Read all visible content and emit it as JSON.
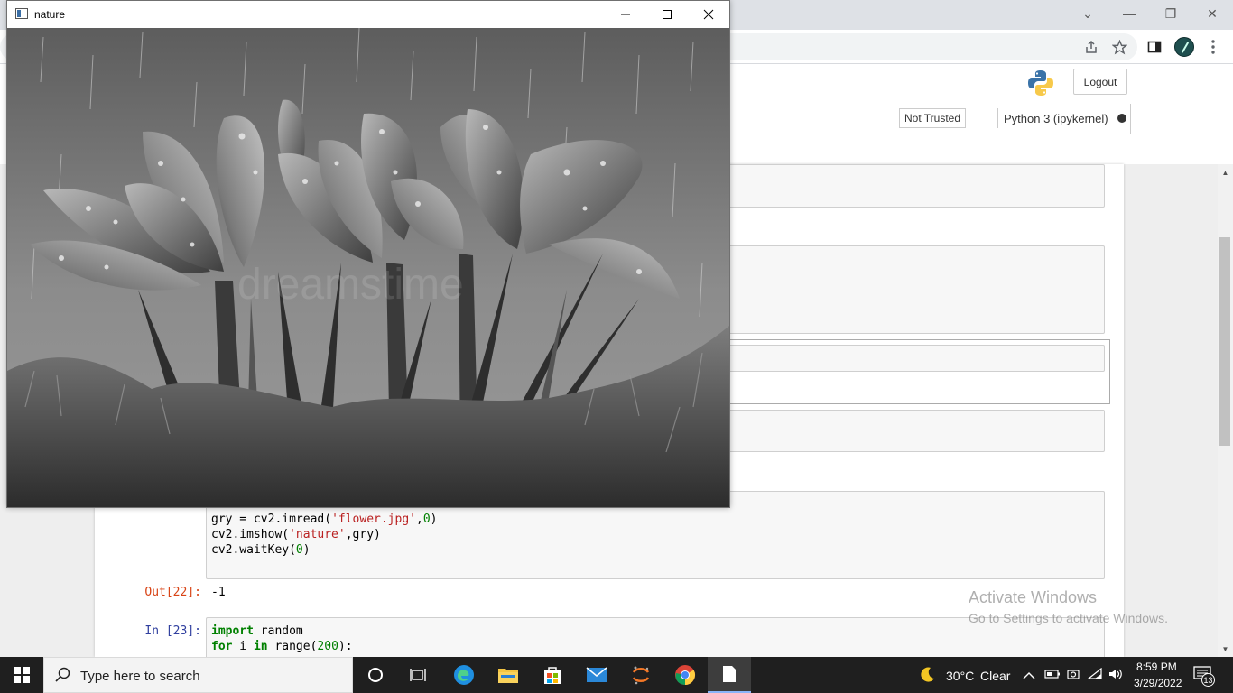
{
  "cv_window": {
    "title": "nature",
    "watermark_text": "dreamstime"
  },
  "browser": {
    "minimize_glyph": "—",
    "restore_glyph": "❐",
    "close_glyph": "✕",
    "tab_search_glyph": "⌄"
  },
  "jupyter": {
    "logout_label": "Logout",
    "trusted_label": "Not Trusted",
    "kernel_label": "Python 3 (ipykernel)"
  },
  "notebook": {
    "cell22": {
      "out_prompt": "Out[22]:",
      "output": "-1"
    },
    "cell23": {
      "in_prompt": "In [23]:"
    }
  },
  "watermark": {
    "title": "Activate Windows",
    "subtitle": "Go to Settings to activate Windows."
  },
  "taskbar": {
    "search_placeholder": "Type here to search",
    "weather_temp": "30°C",
    "weather_desc": "Clear",
    "time": "8:59 PM",
    "date": "3/29/2022",
    "notification_count": "13"
  },
  "colors": {
    "prompt_in": "#303f9f",
    "prompt_out": "#d84315",
    "taskbar": "#1f1f1f"
  }
}
